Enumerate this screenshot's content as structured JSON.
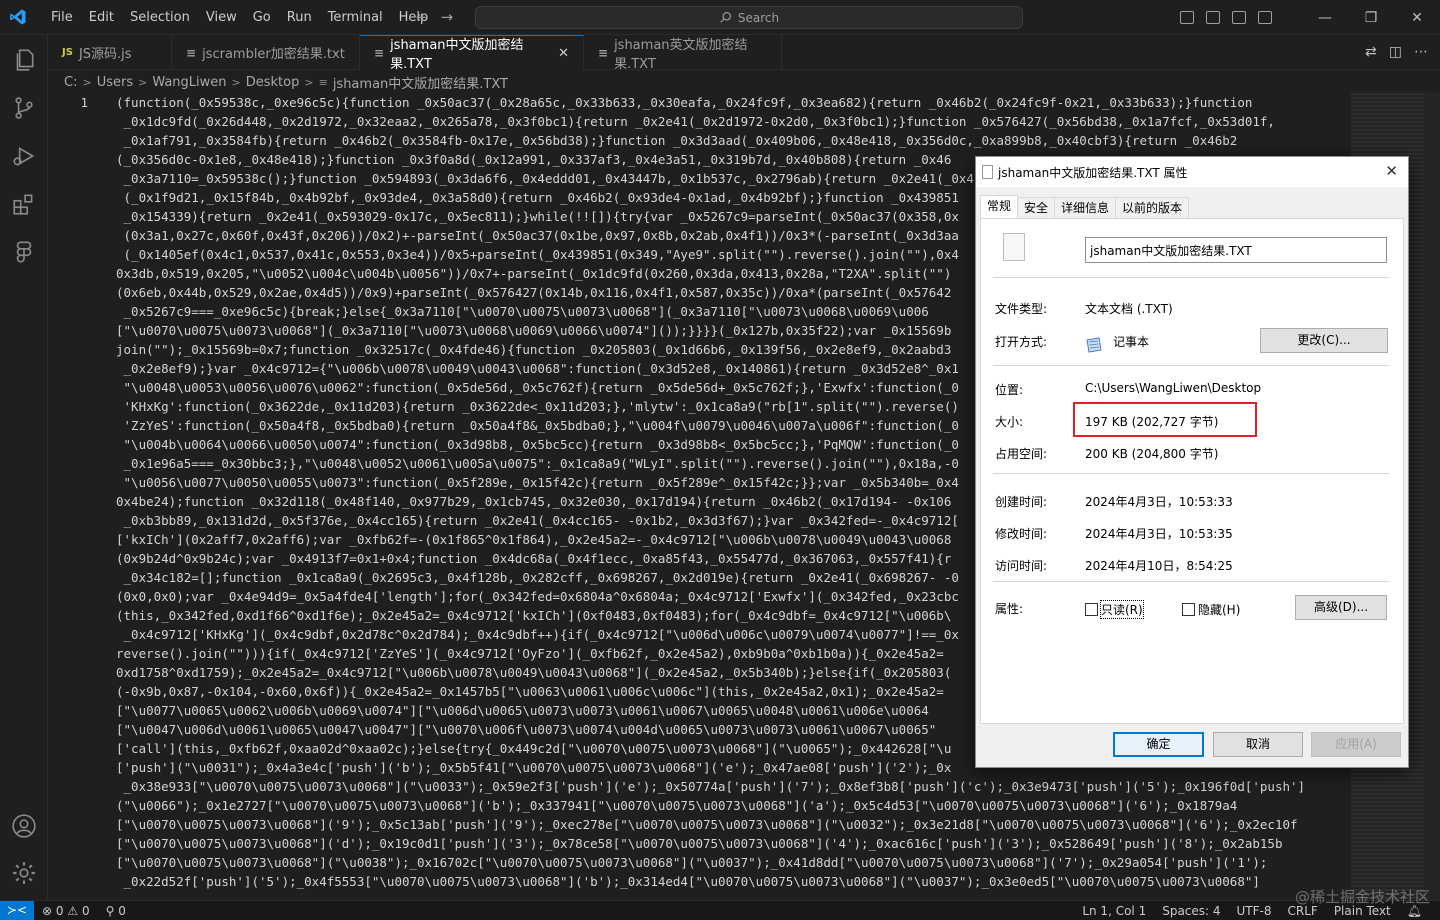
{
  "menu": [
    "File",
    "Edit",
    "Selection",
    "View",
    "Go",
    "Run",
    "Terminal",
    "Help"
  ],
  "search": {
    "label": "Search"
  },
  "tabs": [
    {
      "label": "JS源码.js",
      "icon": "JS"
    },
    {
      "label": "jscrambler加密结果.txt",
      "icon": "≡"
    },
    {
      "label": "jshaman中文版加密结果.TXT",
      "icon": "≡"
    },
    {
      "label": "jshaman英文版加密结果.TXT",
      "icon": "≡"
    }
  ],
  "breadcrumb": [
    "C:",
    "Users",
    "WangLiwen",
    "Desktop",
    "jshaman中文版加密结果.TXT"
  ],
  "editor": {
    "line_number": "1",
    "lines": [
      "(function(_0x59538c,_0xe96c5c){function _0x50ac37(_0x28a65c,_0x33b633,_0x30eafa,_0x24fc9f,_0x3ea682){return _0x46b2(_0x24fc9f-0x21,_0x33b633);}function",
      " _0x1dc9fd(_0x26d448,_0x2d1972,_0x32eaa2,_0x265a78,_0x3f0bc1){return _0x2e41(_0x2d1972-0x2d0,_0x3f0bc1);}function _0x576427(_0x56bd38,_0x1a7fcf,_0x53d01f,",
      " _0x1af791,_0x3584fb){return _0x46b2(_0x3584fb-0x17e,_0x56bd38);}function _0x3d3aad(_0x409b06,_0x48e418,_0x356d0c,_0xa899b8,_0x40cbf3){return _0x46b2",
      "(_0x356d0c-0x1e8,_0x48e418);}function _0x3f0a8d(_0x12a991,_0x337af3,_0x4e3a51,_0x319b7d,_0x40b808){return _0x46",
      " _0x3a7110=_0x59538c();}function _0x594893(_0x3da6f6,_0x4eddd01,_0x43447b,_0x1b537c,_0x2796ab){return _0x2e41(_0x4",
      " (_0x1f9d21,_0x15f84b,_0x4b92bf,_0x93de4,_0x3a58d0){return _0x46b2(_0x93de4-0x1ad,_0x4b92bf);}function _0x439851",
      " _0x154339){return _0x2e41(_0x593029-0x17c,_0x5ec811);}while(!![]){try{var _0x5267c9=parseInt(_0x50ac37(0x358,0x",
      " (0x3a1,0x27c,0x60f,0x43f,0x206))/0x2)+-parseInt(_0x50ac37(0x1be,0x97,0x8b,0x2ab,0x4f1))/0x3*(-parseInt(_0x3d3aa",
      " (_0x1405ef(0x4c1,0x537,0x41c,0x553,0x3e4))/0x5+parseInt(_0x439851(0x349,\"Aye9\".split(\"\").reverse().join(\"\"),0x4",
      "0x3db,0x519,0x205,\"\\u0052\\u004c\\u004b\\u0056\"))/0x7+-parseInt(_0x1dc9fd(0x260,0x3da,0x413,0x28a,\"T2XA\".split(\"\")",
      "(0x6eb,0x44b,0x529,0x2ae,0x4d5))/0x9)+parseInt(_0x576427(0x14b,0x116,0x4f1,0x587,0x35c))/0xa*(parseInt(_0x57642",
      " _0x5267c9===_0xe96c5c){break;}else{_0x3a7110[\"\\u0070\\u0075\\u0073\\u0068\"](_0x3a7110[\"\\u0073\\u0068\\u0069\\u006",
      "[\"\\u0070\\u0075\\u0073\\u0068\"](_0x3a7110[\"\\u0073\\u0068\\u0069\\u0066\\u0074\"]());}}}}(_0x127b,0x35f22);var _0x15569b",
      "join(\"\");_0x15569b=0x7;function _0x32517c(_0x4fde46){function _0x205803(_0x1d66b6,_0x139f56,_0x2e8ef9,_0x2aabd3",
      " _0x2e8ef9);}var _0x4c9712={\"\\u006b\\u0078\\u0049\\u0043\\u0068\":function(_0x3d52e8,_0x140861){return _0x3d52e8^_0x1",
      " \"\\u0048\\u0053\\u0056\\u0076\\u0062\":function(_0x5de56d,_0x5c762f){return _0x5de56d+_0x5c762f;},'Exwfx':function(_0",
      " 'KHxKg':function(_0x3622de,_0x11d203){return _0x3622de<_0x11d203;},'mlytw':_0x1ca8a9(\"rb[1\".split(\"\").reverse()",
      " 'ZzYeS':function(_0x50a4f8,_0x5bdba0){return _0x50a4f8&_0x5bdba0;},\"\\u004f\\u0079\\u0046\\u007a\\u006f\":function(_0",
      " \"\\u004b\\u0064\\u0066\\u0050\\u0074\":function(_0x3d98b8,_0x5bc5cc){return _0x3d98b8<_0x5bc5cc;},'PqMQW':function(_0",
      " _0x1e96a5===_0x30bbc3;},\"\\u0048\\u0052\\u0061\\u005a\\u0075\":_0x1ca8a9(\"WLyI\".split(\"\").reverse().join(\"\"),0x18a,-0",
      " \"\\u0056\\u0077\\u0050\\u0055\\u0073\":function(_0x5f289e,_0x15f42c){return _0x5f289e^_0x15f42c;}};var _0x5b340b=_0x4",
      "0x4be24);function _0x32d118(_0x48f140,_0x977b29,_0x1cb745,_0x32e030,_0x17d194){return _0x46b2(_0x17d194- -0x106",
      " _0xb3bb89,_0x131d2d,_0x5f376e,_0x4cc165){return _0x2e41(_0x4cc165- -0x1b2,_0x3d3f67);}var _0x342fed=-_0x4c9712[",
      "['kxICh'](0x2aff7,0x2aff6);var _0xfb62f=-(0x1f865^0x1f864),_0x2e45a2=-_0x4c9712[\"\\u006b\\u0078\\u0049\\u0043\\u0068",
      "(0x9b24d^0x9b24c);var _0x4913f7=0x1+0x4;function _0x4dc68a(_0x4f1ecc,_0xa85f43,_0x55477d,_0x367063,_0x557f41){r",
      " _0x34c182=[];function _0x1ca8a9(_0x2695c3,_0x4f128b,_0x282cff,_0x698267,_0x2d019e){return _0x2e41(_0x698267- -0",
      "(0x0,0x0);var _0x4e94d9=_0x5a4fde4['length'];for(_0x342fed=0x6804a^0x6804a;_0x4c9712['Exwfx'](_0x342fed,_0x23cbc",
      "(this,_0x342fed,0xd1f66^0xd1f6e);_0x2e45a2=_0x4c9712['kxICh'](0xf0483,0xf0483);for(_0x4c9dbf=_0x4c9712[\"\\u006b\\",
      " _0x4c9712['KHxKg'](_0x4c9dbf,0x2d78c^0x2d784);_0x4c9dbf++){if(_0x4c9712[\"\\u006d\\u006c\\u0079\\u0074\\u0077\"]!==_0x",
      "reverse().join(\"\"))){if(_0x4c9712['ZzYeS'](_0x4c9712['OyFzo'](_0xfb62f,_0x2e45a2),0xb9b0a^0xb1b0a)){_0x2e45a2=",
      "0xd1758^0xd1759);_0x2e45a2=_0x4c9712[\"\\u006b\\u0078\\u0049\\u0043\\u0068\"](_0x2e45a2,_0x5b340b);}else{if(_0x205803(",
      "(-0x9b,0x87,-0x104,-0x60,0x6f)){_0x2e45a2=_0x1457b5[\"\\u0063\\u0061\\u006c\\u006c\"](this,_0x2e45a2,0x1);_0x2e45a2=",
      "[\"\\u0077\\u0065\\u0062\\u006b\\u0069\\u0074\"][\"\\u006d\\u0065\\u0073\\u0073\\u0061\\u0067\\u0065\\u0048\\u0061\\u006e\\u0064",
      "[\"\\u0047\\u006d\\u0061\\u0065\\u0047\\u0047\"][\"\\u0070\\u006f\\u0073\\u0074\\u004d\\u0065\\u0073\\u0073\\u0061\\u0067\\u0065\"",
      "['call'](this,_0xfb62f,0xaa02d^0xaa02c);}else{try{_0x449c2d[\"\\u0070\\u0075\\u0073\\u0068\"](\"\\u0065\");_0x442628[\"\\u",
      "['push'](\"\\u0031\");_0x4a3e4c['push']('b');_0x5b5f41[\"\\u0070\\u0075\\u0073\\u0068\"]('e');_0x47ae08['push']('2');_0x",
      " _0x38e933[\"\\u0070\\u0075\\u0073\\u0068\"](\"\\u0033\");_0x59e2f3['push']('e');_0x50774a['push']('7');_0x8ef3b8['push']('c');_0x3e9473['push']('5');_0x196f0d['push']",
      "(\"\\u0066\");_0x1e2727[\"\\u0070\\u0075\\u0073\\u0068\"]('b');_0x337941[\"\\u0070\\u0075\\u0073\\u0068\"]('a');_0x5c4d53[\"\\u0070\\u0075\\u0073\\u0068\"]('6');_0x1879a4",
      "[\"\\u0070\\u0075\\u0073\\u0068\"]('9');_0x5c13ab['push']('9');_0xec278e[\"\\u0070\\u0075\\u0073\\u0068\"](\"\\u0032\");_0x3e21d8[\"\\u0070\\u0075\\u0073\\u0068\"]('6');_0x2ec10f",
      "[\"\\u0070\\u0075\\u0073\\u0068\"]('d');_0x19c0d1['push']('3');_0x78ce58[\"\\u0070\\u0075\\u0073\\u0068\"]('4');_0xac616c['push']('3');_0x528649['push']('8');_0x2ab15b",
      "[\"\\u0070\\u0075\\u0073\\u0068\"](\"\\u0038\");_0x16702c[\"\\u0070\\u0075\\u0073\\u0068\"](\"\\u0037\");_0x41d8dd[\"\\u0070\\u0075\\u0073\\u0068\"]('7');_0x29a054['push']('1');",
      " _0x22d52f['push']('5');_0x4f5553[\"\\u0070\\u0075\\u0073\\u0068\"]('b');_0x314ed4[\"\\u0070\\u0075\\u0073\\u0068\"](\"\\u0037\");_0x3e0ed5[\"\\u0070\\u0075\\u0073\\u0068\"]"
    ]
  },
  "status": {
    "remote": "≻<",
    "errors": "0",
    "warnings": "0",
    "ports": "0",
    "position": "Ln 1, Col 1",
    "spaces": "Spaces: 4",
    "encoding": "UTF-8",
    "eol": "CRLF",
    "language": "Plain Text"
  },
  "watermark": "@稀土掘金技术社区",
  "dialog": {
    "title": "jshaman中文版加密结果.TXT 属性",
    "tabs": [
      "常规",
      "安全",
      "详细信息",
      "以前的版本"
    ],
    "filename": "jshaman中文版加密结果.TXT",
    "rows": {
      "type_label": "文件类型:",
      "type_value": "文本文档 (.TXT)",
      "open_label": "打开方式:",
      "open_value": "记事本",
      "change_btn": "更改(C)...",
      "location_label": "位置:",
      "location_value": "C:\\Users\\WangLiwen\\Desktop",
      "size_label": "大小:",
      "size_value": "197 KB (202,727 字节)",
      "disk_label": "占用空间:",
      "disk_value": "200 KB (204,800 字节)",
      "created_label": "创建时间:",
      "created_value": "2024年4月3日，10:53:33",
      "modified_label": "修改时间:",
      "modified_value": "2024年4月3日，10:53:35",
      "accessed_label": "访问时间:",
      "accessed_value": "2024年4月10日，8:54:25",
      "attr_label": "属性:",
      "readonly": "只读(R)",
      "hidden": "隐藏(H)",
      "advanced_btn": "高级(D)..."
    },
    "buttons": {
      "ok": "确定",
      "cancel": "取消",
      "apply": "应用(A)"
    }
  },
  "colors": {
    "accent": "#0078d4",
    "highlight": "#e0202a"
  }
}
